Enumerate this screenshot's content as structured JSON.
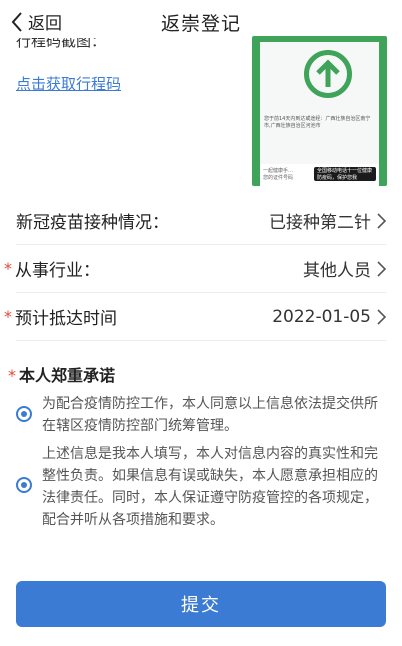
{
  "nav": {
    "back_label": "返回",
    "title": "返崇登记"
  },
  "trip": {
    "label": "行程码截图：",
    "link": "点击获取行程码"
  },
  "card": {
    "text": "您于前14天内到达或途经：广西壮族自治区南宁市,广西壮族自治区河池市",
    "tag_left": "一起健康手…\n您的证件号码",
    "tag_right": "全国移动电话十一位健康\n防疫码，保护您我"
  },
  "rows": [
    {
      "label": "新冠疫苗接种情况：",
      "value": "已接种第二针",
      "required": false
    },
    {
      "label": "从事行业：",
      "value": "其他人员",
      "required": true
    },
    {
      "label": "预计抵达时间",
      "value": "2022-01-05",
      "required": true
    }
  ],
  "promise": {
    "title": "本人郑重承诺",
    "items": [
      "为配合疫情防控工作，本人同意以上信息依法提交供所在辖区疫情防控部门统筹管理。",
      "上述信息是我本人填写，本人对信息内容的真实性和完整性负责。如果信息有误或缺失，本人愿意承担相应的法律责任。同时，本人保证遵守防疫管控的各项规定，配合并听从各项措施和要求。"
    ]
  },
  "submit_label": "提交",
  "colors": {
    "accent": "#3b7bd4",
    "required": "#e0493b",
    "card_green": "#3fa35a"
  }
}
